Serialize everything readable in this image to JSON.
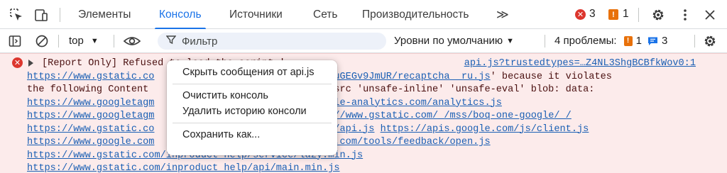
{
  "tabs": {
    "items": [
      {
        "label": "Элементы"
      },
      {
        "label": "Консоль"
      },
      {
        "label": "Источники"
      },
      {
        "label": "Сеть"
      },
      {
        "label": "Производительность"
      }
    ],
    "more_glyph": "≫",
    "error_count": "3",
    "warning_count": "1"
  },
  "toolbar": {
    "context": "top",
    "filter_placeholder": "Фильтр",
    "levels": "Уровни по умолчанию",
    "issues_label": "4 проблемы:",
    "issues_warn": "1",
    "issues_info": "3"
  },
  "message": {
    "source_link": "api.js?trustedtypes=…Z4NL3ShgBCBfkWov0:1",
    "lines": [
      [
        {
          "t": "[Report Only] Refused to load the script '",
          "k": "plain"
        }
      ],
      [
        {
          "t": "https://www.gstatic.co",
          "k": "lnk"
        },
        {
          "t": "                       ",
          "k": "plain"
        },
        {
          "t": "beIbCkK4uGEGv9JmUR/recaptcha__ru.js",
          "k": "lnk"
        },
        {
          "t": "' because it violates",
          "k": "plain"
        }
      ],
      [
        {
          "t": "the following Content ",
          "k": "plain"
        },
        {
          "t": "                       ",
          "k": "plain"
        },
        {
          "t": "\"script-src 'unsafe-inline' 'unsafe-eval' blob: data:",
          "k": "plain"
        }
      ],
      [
        {
          "t": "https://www.googletagm",
          "k": "lnk"
        },
        {
          "t": "                       ",
          "k": "plain"
        },
        {
          "t": "www.google-analytics.com/analytics.js",
          "k": "lnk"
        }
      ],
      [
        {
          "t": "https://www.googletagm",
          "k": "lnk"
        },
        {
          "t": "                         ",
          "k": "plain"
        },
        {
          "t": "https://www.gstatic.com/_/mss/boq-one-google/_/",
          "k": "lnk"
        }
      ],
      [
        {
          "t": "https://www.gstatic.co",
          "k": "lnk"
        },
        {
          "t": "                     ",
          "k": "plain"
        },
        {
          "t": "gle.com/js/api.js",
          "k": "lnk"
        },
        {
          "t": " ",
          "k": "plain"
        },
        {
          "t": "https://apis.google.com/js/client.js",
          "k": "lnk"
        }
      ],
      [
        {
          "t": "https://www.google.com",
          "k": "lnk"
        },
        {
          "t": "                 ",
          "k": "plain"
        },
        {
          "t": "s://www.google.com/tools/feedback/open.js",
          "k": "lnk"
        }
      ],
      [
        {
          "t": "https://www.gstatic.com/inproduct_help/service/lazy.min.js",
          "k": "lnk"
        }
      ],
      [
        {
          "t": "https://www.gstatic.com/inproduct_help/api/main.min.js",
          "k": "lnk"
        }
      ]
    ]
  },
  "context_menu": {
    "hide_messages": "Скрыть сообщения от api.js",
    "clear_console": "Очистить консоль",
    "clear_history": "Удалить историю консоли",
    "save_as": "Сохранить как..."
  },
  "colors": {
    "accent": "#1a73e8",
    "error": "#dc362e",
    "warning": "#e8710a",
    "info": "#1a73e8",
    "error_bg": "#fcebeb"
  }
}
